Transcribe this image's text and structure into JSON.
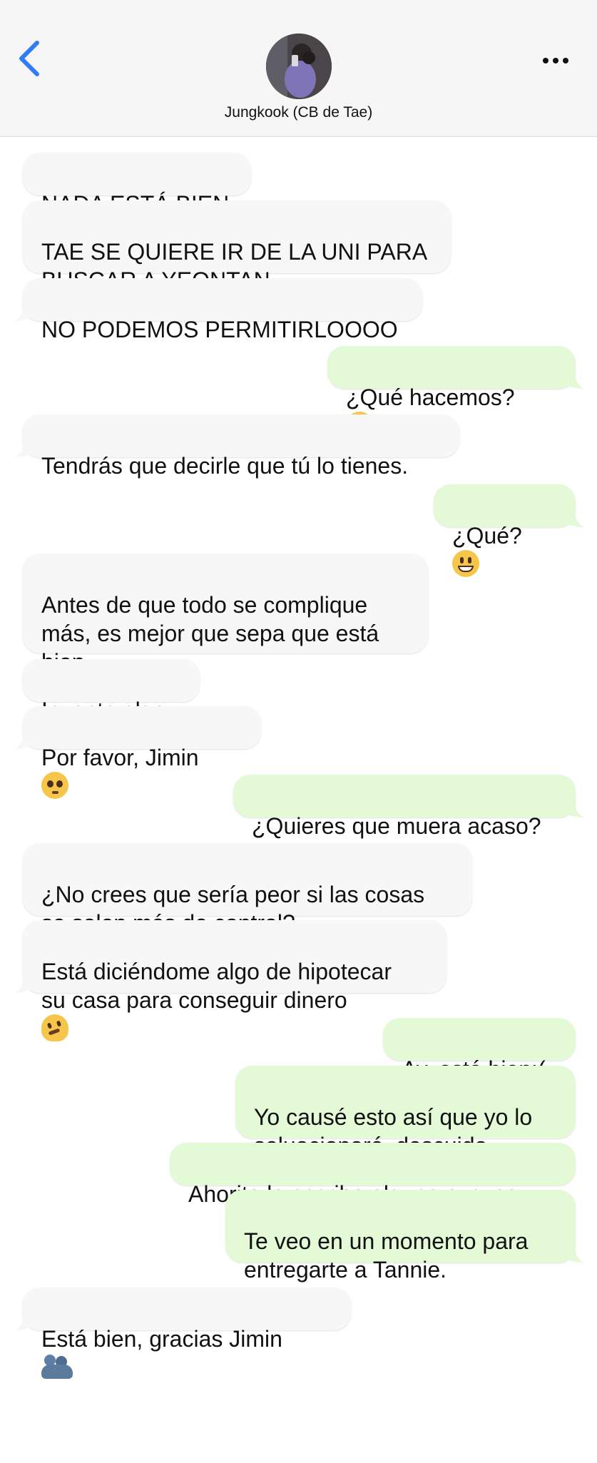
{
  "header": {
    "contact_name": "Jungkook (CB de Tae)",
    "back_icon": "chevron-left-icon",
    "more_icon": "ellipsis-icon"
  },
  "colors": {
    "accent": "#2f7df6",
    "incoming_bubble": "#f7f7f7",
    "outgoing_bubble": "#e4fad7",
    "header_bg": "#f6f6f6"
  },
  "messages": [
    {
      "side": "in",
      "text": "NADA ESTÁ BIEN"
    },
    {
      "side": "in",
      "text": "TAE SE QUIERE IR DE LA UNI PARA\nBUSCAR A YEONTAN"
    },
    {
      "side": "in",
      "text": "NO PODEMOS PERMITIRLOOOO"
    },
    {
      "side": "out",
      "text": "¿Qué hacemos?",
      "emoji": "pleading-face-emoji"
    },
    {
      "side": "in",
      "text": "Tendrás que decirle que tú lo tienes."
    },
    {
      "side": "out",
      "text": "¿Qué?",
      "emoji": "grinning-face-emoji"
    },
    {
      "side": "in",
      "text": "Antes de que todo se complique\nmás, es mejor que sepa que está\nbien."
    },
    {
      "side": "in",
      "text": "Inventa algo."
    },
    {
      "side": "in",
      "text": "Por favor, Jimin",
      "emoji": "pleading-face-emoji"
    },
    {
      "side": "out",
      "text": "¿Quieres que muera acaso?"
    },
    {
      "side": "in",
      "text": "¿No crees que sería peor si las cosas\nse salen más de control?"
    },
    {
      "side": "in",
      "text": "Está diciéndome algo de hipotecar\nsu casa para conseguir dinero",
      "emoji": "melting-face-emoji"
    },
    {
      "side": "out",
      "text": "Ay, está bien:("
    },
    {
      "side": "out",
      "text": "Yo causé esto así que yo lo\nsoluacionaré, descuida."
    },
    {
      "side": "out",
      "text": "Ahorita le escribo alguna excusa."
    },
    {
      "side": "out",
      "text": "Te veo en un momento para\nentregarte a Tannie."
    },
    {
      "side": "in",
      "text": "Está bien, gracias Jimin",
      "emoji": "people-hugging-emoji"
    }
  ]
}
